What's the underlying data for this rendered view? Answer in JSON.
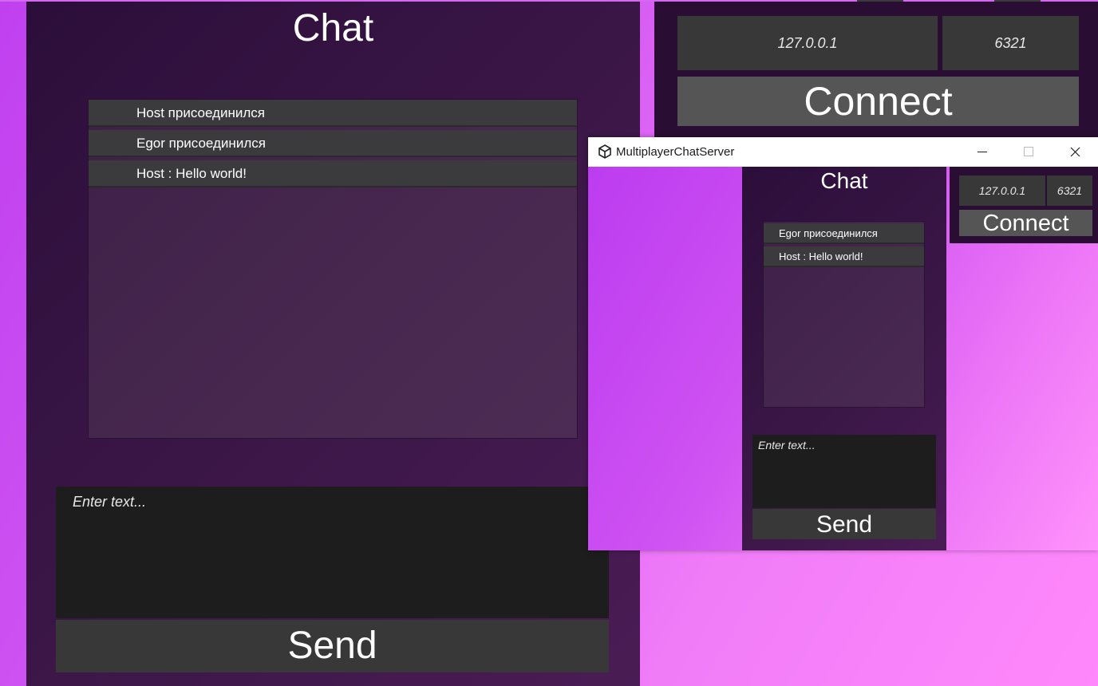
{
  "main_app": {
    "title": "Chat",
    "messages": [
      "Host  присоединился",
      "Egor  присоединился",
      "Host : Hello world!"
    ],
    "input_placeholder": "Enter text...",
    "send_label": "Send",
    "connection": {
      "ip": "127.0.0.1",
      "port": "6321",
      "connect_label": "Connect"
    }
  },
  "window": {
    "title": "MultiplayerChatServer",
    "icon": "unity-logo-icon",
    "controls": [
      "minimize-icon",
      "maximize-icon",
      "close-icon"
    ],
    "app": {
      "title": "Chat",
      "messages": [
        "Egor  присоединился",
        "Host : Hello world!"
      ],
      "input_placeholder": "Enter text...",
      "send_label": "Send",
      "connection": {
        "ip": "127.0.0.1",
        "port": "6321",
        "connect_label": "Connect"
      }
    }
  },
  "colors": {
    "background_gradient": [
      "#c040f0",
      "#ff88fb"
    ],
    "panel": "#2c0e3a",
    "message_row": "#3b3b3e",
    "input": "#1d1d1d",
    "button": "#383838",
    "connect_button": "#555555"
  }
}
